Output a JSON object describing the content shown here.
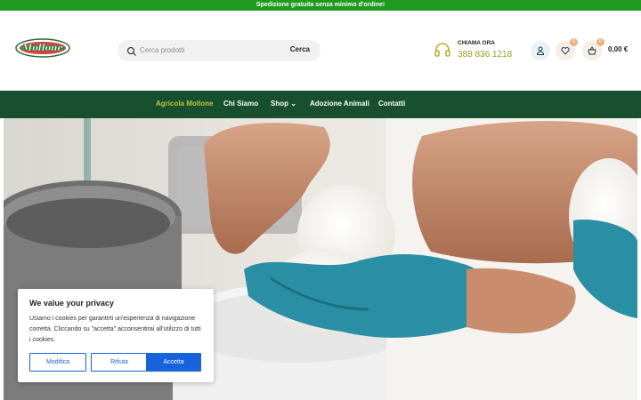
{
  "topbar": {
    "text": "Spedizione gratuita senza minimo d'ordine!"
  },
  "header": {
    "logo_text": "Mollone",
    "search_placeholder": "Cerca prodotti",
    "search_button": "Cerca",
    "call_title": "CHIAMA ORA",
    "call_number": "388 836 1218",
    "wishlist_count": "0",
    "cart_count": "0",
    "cart_total": "0,00 €"
  },
  "nav": {
    "items": [
      "Agricola Mollone",
      "Chi Siamo",
      "Shop",
      "Adozione Animali",
      "Contatti"
    ],
    "shop_chevron": "⌄"
  },
  "cookie": {
    "title": "We value your privacy",
    "text": "Usiamo i cookies per garantirti un'esperienza di navigazione corretta. Cliccando su \"accetta\" acconsentirai all'utilizzo di tutti i cookies.",
    "btn_customize": "Modifica",
    "btn_reject": "Rifiuta",
    "btn_accept": "Accetta"
  },
  "colors": {
    "topbar": "#1f9a1f",
    "nav": "#174f2f",
    "nav_active": "#c2c63a",
    "accent_blue": "#1863dc"
  }
}
